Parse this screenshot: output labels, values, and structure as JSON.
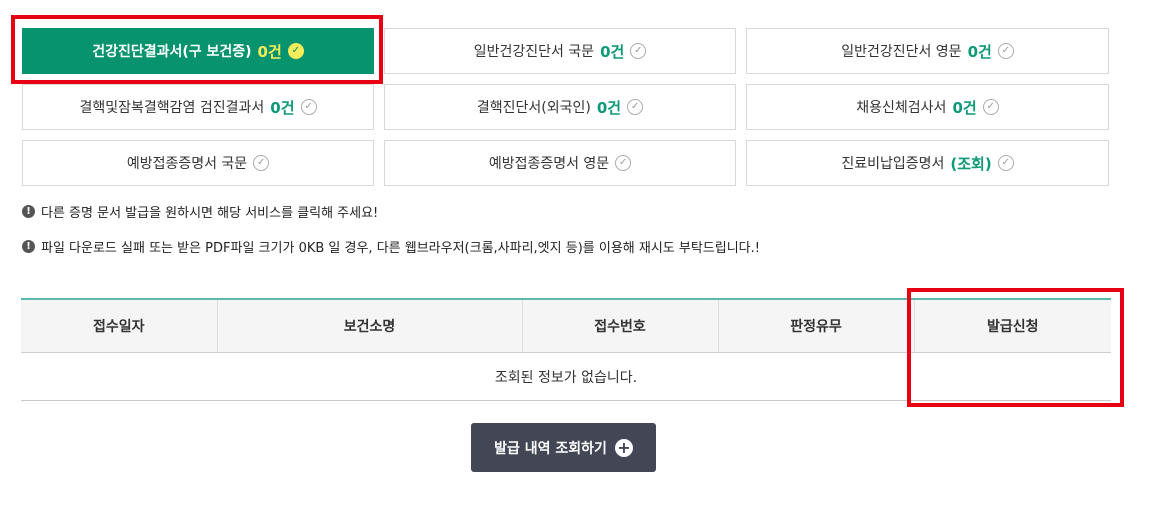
{
  "cards": [
    {
      "label": "건강진단결과서(구 보건증)",
      "count": "0건",
      "active": true
    },
    {
      "label": "일반건강진단서 국문",
      "count": "0건"
    },
    {
      "label": "일반건강진단서 영문",
      "count": "0건"
    },
    {
      "label": "결핵및잠복결핵감염 검진결과서",
      "count": "0건"
    },
    {
      "label": "결핵진단서(외국인)",
      "count": "0건"
    },
    {
      "label": "채용신체검사서",
      "count": "0건"
    },
    {
      "label": "예방접종증명서 국문",
      "count": ""
    },
    {
      "label": "예방접종증명서 영문",
      "count": ""
    },
    {
      "label": "진료비납입증명서",
      "count": "(조회)"
    }
  ],
  "notices": [
    "다른 증명 문서 발급을 원하시면 해당 서비스를 클릭해 주세요!",
    "파일 다운로드 실패 또는 받은 PDF파일 크기가 0KB 일 경우, 다른 웹브라우저(크롬,사파리,엣지 등)를 이용해 재시도 부탁드립니다.!"
  ],
  "table": {
    "columns": [
      "접수일자",
      "보건소명",
      "접수번호",
      "판정유무",
      "발급신청"
    ],
    "empty_message": "조회된 정보가 없습니다."
  },
  "history_button": {
    "label": "발급 내역 조회하기"
  },
  "colors": {
    "accent": "#07936e",
    "count": "#0e9a78",
    "highlight": "#f4ec5a",
    "button": "#434755",
    "annotation": "#e60012"
  }
}
